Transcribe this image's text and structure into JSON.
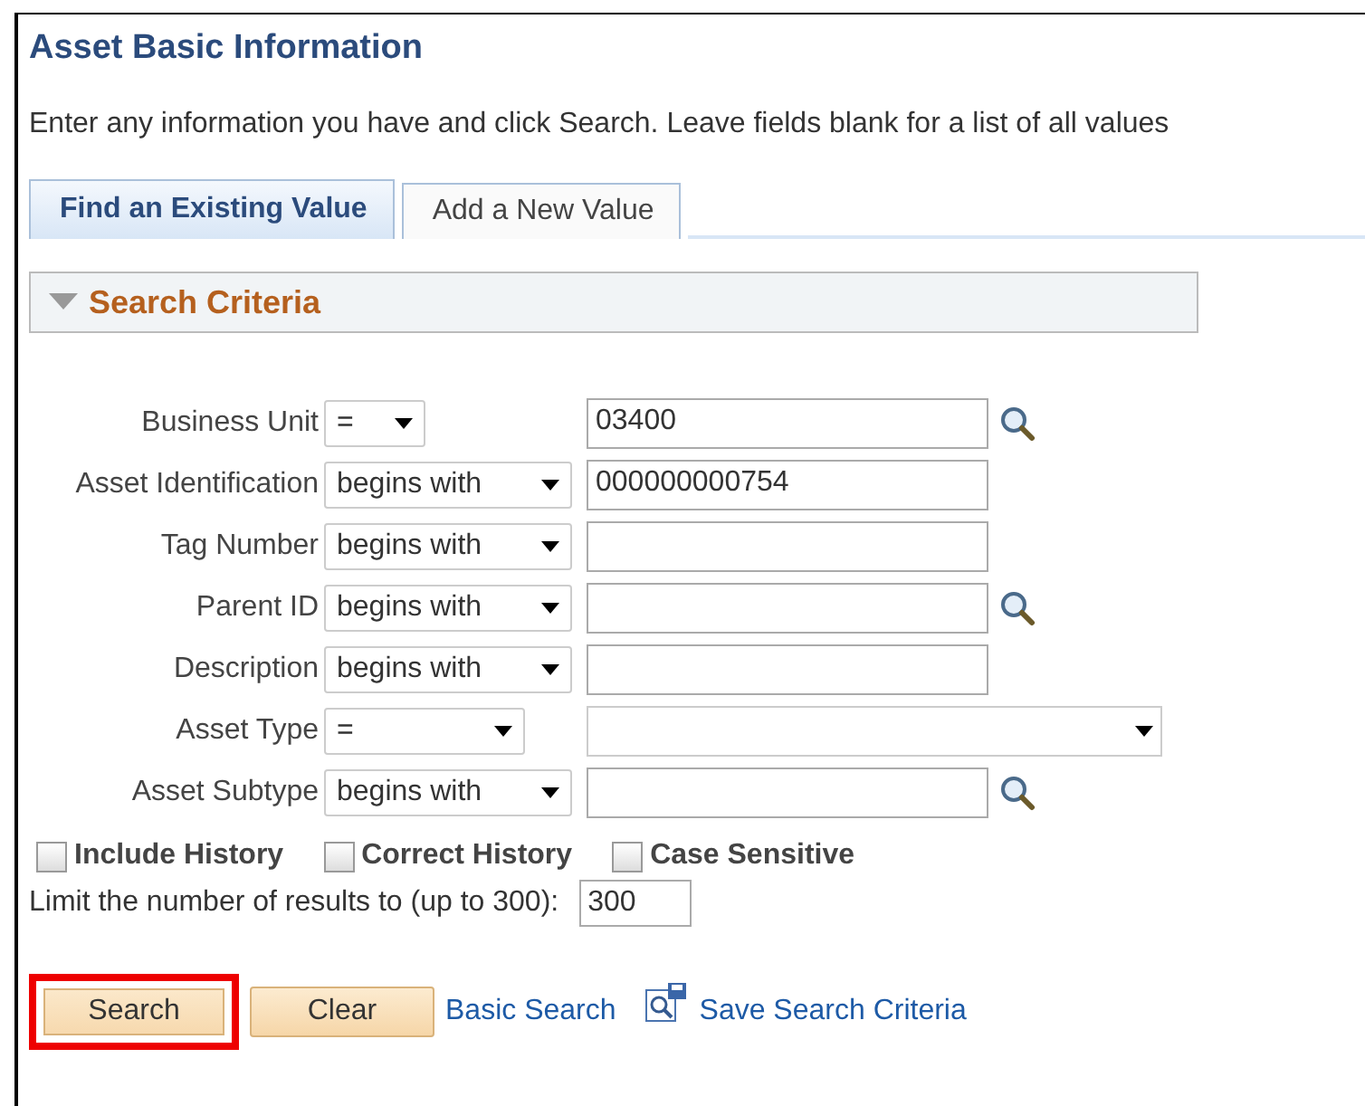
{
  "title": "Asset Basic Information",
  "instructions": "Enter any information you have and click Search. Leave fields blank for a list of all values",
  "tabs": [
    {
      "label": "Find an Existing Value",
      "selected": true
    },
    {
      "label": "Add a New Value",
      "selected": false
    }
  ],
  "section": {
    "title": "Search Criteria",
    "expanded": true
  },
  "criteria": [
    {
      "label": "Business Unit",
      "operator": {
        "text": "=",
        "kind": "short"
      },
      "field": {
        "kind": "text",
        "value": "03400"
      },
      "lookup": true
    },
    {
      "label": "Asset Identification",
      "operator": {
        "text": "begins with",
        "kind": "long"
      },
      "field": {
        "kind": "text",
        "value": "000000000754"
      },
      "lookup": false
    },
    {
      "label": "Tag Number",
      "operator": {
        "text": "begins with",
        "kind": "long"
      },
      "field": {
        "kind": "text"
      },
      "lookup": false
    },
    {
      "label": "Parent ID",
      "operator": {
        "text": "begins with",
        "kind": "long"
      },
      "field": {
        "kind": "text"
      },
      "lookup": true
    },
    {
      "label": "Description",
      "operator": {
        "text": "begins with",
        "kind": "long"
      },
      "field": {
        "kind": "text"
      },
      "lookup": false
    },
    {
      "label": "Asset Type",
      "operator": {
        "text": "=",
        "kind": "medium"
      },
      "field": {
        "kind": "select"
      },
      "lookup": false
    },
    {
      "label": "Asset Subtype",
      "operator": {
        "text": "begins with",
        "kind": "long"
      },
      "field": {
        "kind": "text"
      },
      "lookup": true
    }
  ],
  "options": [
    {
      "label": "Include History",
      "checked": false
    },
    {
      "label": "Correct History",
      "checked": false
    },
    {
      "label": "Case Sensitive",
      "checked": false
    }
  ],
  "limit": {
    "label": "Limit the number of results to (up to 300):",
    "value": "300"
  },
  "buttons": [
    {
      "label": "Search",
      "highlighted": true
    },
    {
      "label": "Clear",
      "highlighted": false
    }
  ],
  "links": [
    {
      "label": "Basic Search",
      "icon": false
    },
    {
      "label": "Save Search Criteria",
      "icon": true
    }
  ]
}
